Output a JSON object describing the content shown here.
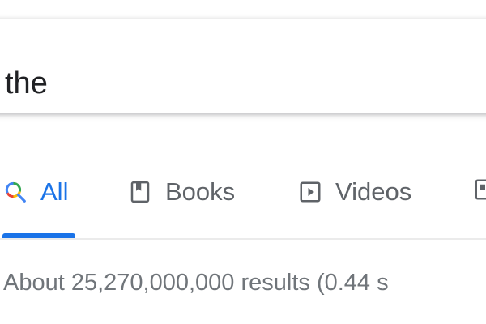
{
  "search": {
    "query": "the"
  },
  "tabs": [
    {
      "label": "All",
      "icon": "search-icon",
      "active": true
    },
    {
      "label": "Books",
      "icon": "book-icon",
      "active": false
    },
    {
      "label": "Videos",
      "icon": "play-icon",
      "active": false
    }
  ],
  "results": {
    "stats": "About 25,270,000,000 results (0.44 s"
  },
  "colors": {
    "accent": "#1a73e8",
    "tab_text": "#5f6368",
    "stats_text": "#70757a"
  }
}
